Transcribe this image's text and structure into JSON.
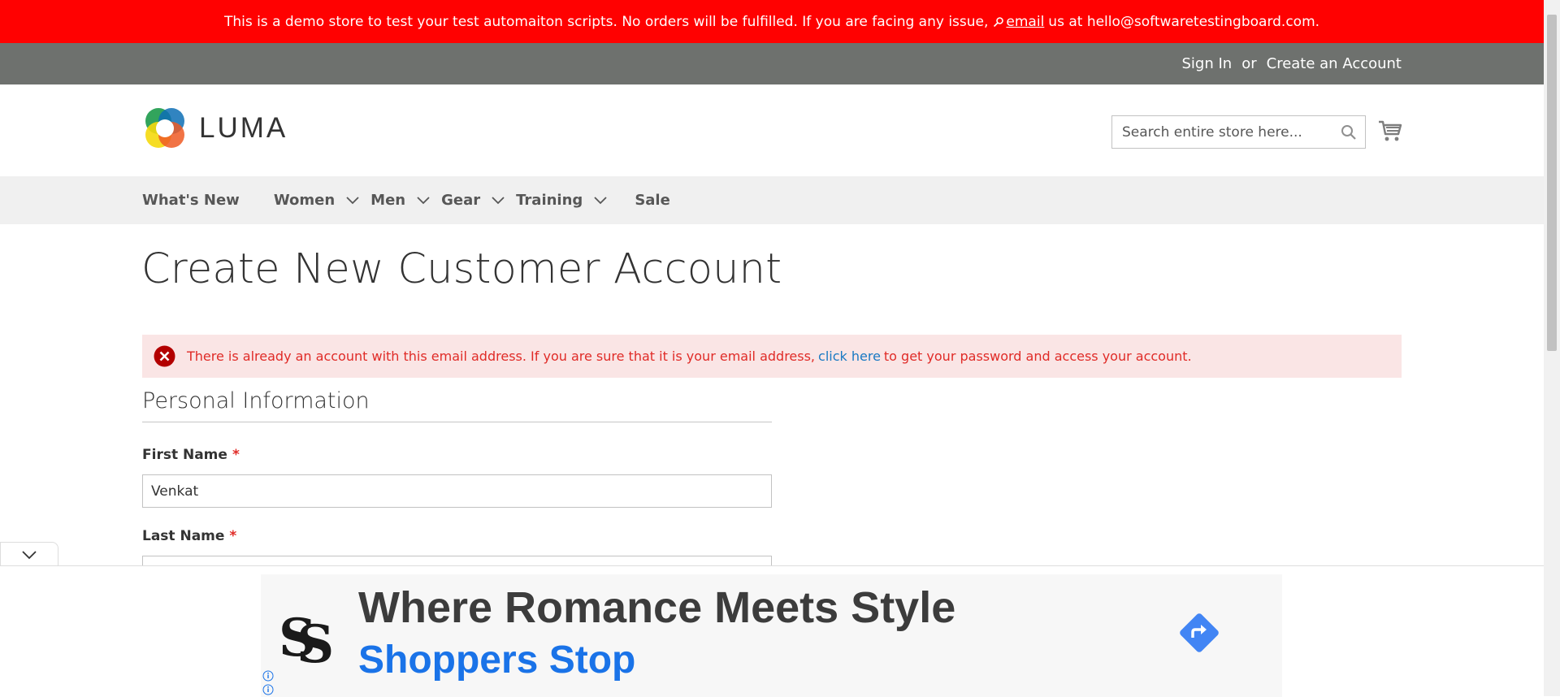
{
  "demo_banner": {
    "text_before": "This is a demo store to test your test automaiton scripts. No orders will be fulfilled. If you are facing any issue,",
    "email_link": "email",
    "text_after": "us at hello@softwaretestingboard.com."
  },
  "header_links": {
    "sign_in": "Sign In",
    "or": "or",
    "create_account": "Create an Account"
  },
  "logo": {
    "text": "LUMA"
  },
  "search": {
    "placeholder": "Search entire store here..."
  },
  "nav": {
    "items": [
      {
        "label": "What's New"
      },
      {
        "label": "Women"
      },
      {
        "label": "Men"
      },
      {
        "label": "Gear"
      },
      {
        "label": "Training"
      },
      {
        "label": "Sale"
      }
    ]
  },
  "page": {
    "title": "Create New Customer Account",
    "error": {
      "text_before": "There is already an account with this email address. If you are sure that it is your email address,",
      "link": "click here",
      "text_after": "to get your password and access your account."
    }
  },
  "form": {
    "legend": "Personal Information",
    "first_name": {
      "label": "First Name",
      "value": "Venkat"
    },
    "last_name": {
      "label": "Last Name",
      "value": ""
    },
    "required_marker": "*"
  },
  "ad": {
    "headline": "Where Romance Meets Style",
    "brand": "Shoppers Stop"
  },
  "colors": {
    "demo_bar": "#ff0101",
    "top_bar": "#6e716e",
    "error_bg": "#fae5e5",
    "error_text": "#e02b27",
    "link": "#1979c3",
    "ad_brand": "#1a73e8"
  },
  "icons": {
    "search": "search-icon",
    "cart": "cart-icon",
    "error": "error-icon",
    "chevron": "chevron-down-icon",
    "key": "key-icon",
    "collapse": "chevron-down-icon",
    "ad_cta": "directions-icon",
    "ad_info": "info-icon"
  }
}
